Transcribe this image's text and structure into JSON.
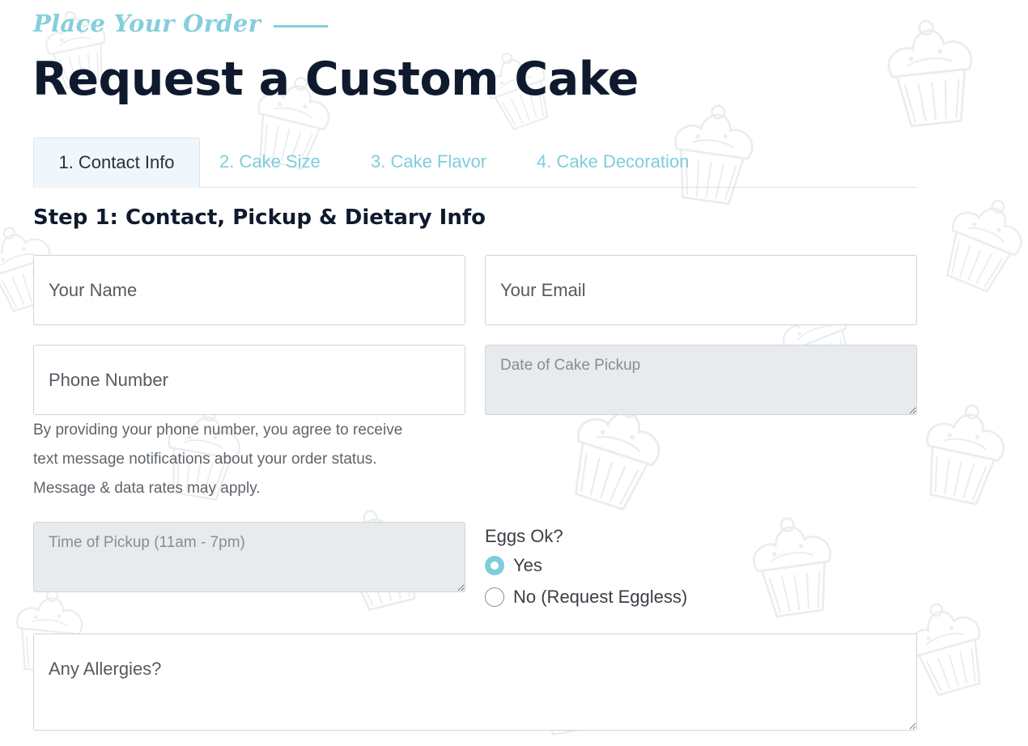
{
  "header": {
    "eyebrow": "Place Your Order",
    "title": "Request a Custom Cake"
  },
  "tabs": [
    {
      "label": "1. Contact Info",
      "active": true
    },
    {
      "label": "2. Cake Size",
      "active": false
    },
    {
      "label": "3. Cake Flavor",
      "active": false
    },
    {
      "label": "4. Cake Decoration",
      "active": false
    }
  ],
  "step": {
    "title": "Step 1: Contact, Pickup & Dietary Info"
  },
  "form": {
    "name_placeholder": "Your Name",
    "email_placeholder": "Your Email",
    "phone_placeholder": "Phone Number",
    "date_placeholder": "Date of Cake Pickup",
    "time_placeholder": "Time of Pickup (11am - 7pm)",
    "allergies_placeholder": "Any Allergies?",
    "phone_notice_lines": [
      "By providing your phone number, you agree to receive",
      "text message notifications about your order status.",
      "Message & data rates may apply."
    ],
    "eggs": {
      "label": "Eggs Ok?",
      "options": [
        {
          "label": "Yes",
          "checked": true
        },
        {
          "label": "No (Request Eggless)",
          "checked": false
        }
      ]
    }
  },
  "colors": {
    "accent": "#84cfdb",
    "heading": "#0f1a2e",
    "disabled_field": "#e8ebee",
    "active_tab_bg": "#f0f7fc"
  },
  "icons": {
    "background_pattern": "cupcake-doodle-pattern",
    "resize_handle": "textarea-resize-grip-icon"
  }
}
